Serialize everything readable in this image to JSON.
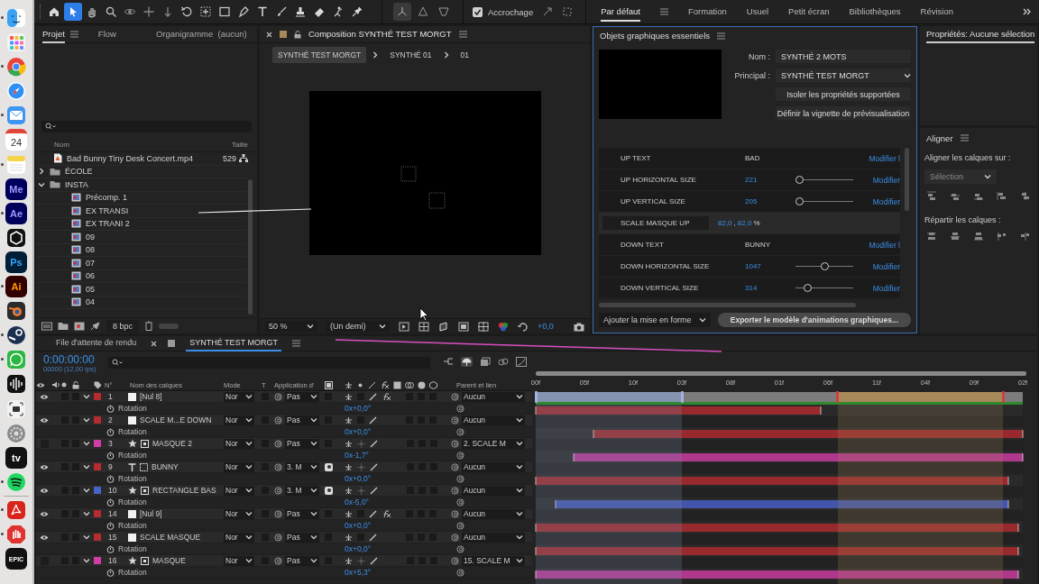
{
  "dock": [
    {
      "kind": "finder",
      "running": true
    },
    {
      "kind": "launchpad",
      "running": false
    },
    {
      "kind": "chrome",
      "running": true
    },
    {
      "kind": "safari",
      "running": false
    },
    {
      "kind": "mail",
      "running": true
    },
    {
      "kind": "calendar",
      "label": "24",
      "running": false
    },
    {
      "kind": "notes",
      "running": true
    },
    {
      "kind": "media",
      "label": "Me",
      "running": false
    },
    {
      "kind": "media",
      "label": "Ae",
      "running": true
    },
    {
      "kind": "capcut",
      "running": false
    },
    {
      "kind": "photo",
      "label": "Ps",
      "running": false
    },
    {
      "kind": "vector",
      "label": "Ai",
      "running": true
    },
    {
      "kind": "blender",
      "running": false
    },
    {
      "kind": "steam",
      "running": true
    },
    {
      "kind": "whatsapp",
      "running": true
    },
    {
      "kind": "voice",
      "running": false
    },
    {
      "kind": "screenshot",
      "running": false
    },
    {
      "kind": "settings",
      "running": false
    },
    {
      "kind": "dark",
      "label": "tv",
      "running": false
    },
    {
      "kind": "spotify",
      "running": true
    },
    {
      "kind": "acrobat",
      "running": true
    },
    {
      "kind": "adblock",
      "running": true
    },
    {
      "kind": "dark",
      "label": "EPIC",
      "running": false
    }
  ],
  "tools": [
    {
      "kind": "home",
      "selected": false
    },
    {
      "kind": "select",
      "selected": true
    },
    {
      "kind": "hand",
      "selected": false
    },
    {
      "kind": "zoom",
      "selected": false
    },
    {
      "kind": "orbit",
      "selected": false
    },
    {
      "kind": "pan",
      "selected": false
    },
    {
      "kind": "dolly",
      "selected": false
    },
    {
      "kind": "rotate",
      "selected": false
    },
    {
      "kind": "anchor",
      "selected": false
    },
    {
      "kind": "rect",
      "selected": false
    },
    {
      "kind": "pen",
      "selected": false
    },
    {
      "kind": "text",
      "selected": false
    },
    {
      "kind": "brush",
      "selected": false
    },
    {
      "kind": "stamp",
      "selected": false
    },
    {
      "kind": "eraser",
      "selected": false
    },
    {
      "kind": "roto",
      "selected": false
    },
    {
      "kind": "puppet",
      "selected": false
    }
  ],
  "axis_tools": [
    {
      "kind": "local",
      "selected": true
    },
    {
      "kind": "world",
      "selected": false
    },
    {
      "kind": "view",
      "selected": false
    }
  ],
  "snapping": {
    "label": "Accrochage",
    "checked": true
  },
  "workspaces": [
    {
      "label": "Par défaut",
      "selected": true
    },
    {
      "label": "Formation",
      "selected": false
    },
    {
      "label": "Usuel",
      "selected": false
    },
    {
      "label": "Petit écran",
      "selected": false
    },
    {
      "label": "Bibliothèques",
      "selected": false
    },
    {
      "label": "Révision",
      "selected": false
    }
  ],
  "project": {
    "tabs": [
      {
        "label": "Projet",
        "selected": true
      },
      {
        "label": "Flow",
        "selected": false
      },
      {
        "label": "Organigramme  (aucun)",
        "selected": false
      }
    ],
    "columns": [
      "Nom",
      "Taille"
    ],
    "items": [
      {
        "kind": "footage",
        "name": "Bad Bunny Tiny Desk Concert.mp4",
        "size": "529"
      },
      {
        "kind": "folder",
        "name": "ÉCOLE",
        "expanded": false
      },
      {
        "kind": "folder",
        "name": "INSTA",
        "expanded": true,
        "children": [
          {
            "kind": "comp",
            "name": "Précomp. 1"
          },
          {
            "kind": "comp",
            "name": "EX TRANSI"
          },
          {
            "kind": "comp",
            "name": "EX TRANI 2"
          },
          {
            "kind": "comp",
            "name": "09"
          },
          {
            "kind": "comp",
            "name": "08"
          },
          {
            "kind": "comp",
            "name": "07"
          },
          {
            "kind": "comp",
            "name": "06"
          },
          {
            "kind": "comp",
            "name": "05"
          },
          {
            "kind": "comp",
            "name": "04"
          }
        ]
      }
    ],
    "depth": "8 bpc"
  },
  "composition": {
    "title": "Composition SYNTHÉ TEST MORGT",
    "breadcrumbs": [
      {
        "label": "SYNTHÉ TEST MORGT",
        "selected": true
      },
      {
        "label": "SYNTHÉ 01",
        "selected": false
      },
      {
        "label": "01",
        "selected": false
      }
    ],
    "zoom": "50 %",
    "resolution": "(Un demi)",
    "exposure": "+0,0"
  },
  "essential_graphics": {
    "title": "Objets graphiques essentiels",
    "name_label": "Nom :",
    "name": "SYNTHÉ 2 MOTS",
    "primary_label": "Principal :",
    "primary": "SYNTHÉ TEST MORGT",
    "buttons": [
      "Isoler les propriétés supportées",
      "Définir la vignette de prévisualisation"
    ],
    "properties": [
      {
        "kind": "text",
        "label": "UP TEXT",
        "value": "BAD",
        "action": "Modifier l"
      },
      {
        "kind": "slider",
        "label": "UP HORIZONTAL SIZE",
        "value": "221",
        "level": 0,
        "action": "Modifier"
      },
      {
        "kind": "slider",
        "label": "UP VERTICAL SIZE",
        "value": "205",
        "level": 0,
        "action": "Modifier"
      },
      {
        "kind": "scale",
        "label": "SCALE MASQUE UP",
        "value": "82,0",
        "separator": ",",
        "value2": "82,0",
        "unit": "%"
      },
      {
        "kind": "text",
        "label": "DOWN TEXT",
        "value": "BUNNY",
        "action": "Modifier l"
      },
      {
        "kind": "slider",
        "label": "DOWN HORIZONTAL SIZE",
        "value": "1047",
        "level": 0.5,
        "action": "Modifier"
      },
      {
        "kind": "slider",
        "label": "DOWN VERTICAL SIZE",
        "value": "314",
        "level": 0.17,
        "action": "Modifier"
      }
    ],
    "format": "Ajouter la mise en forme",
    "export": "Exporter le modèle d'animations graphiques..."
  },
  "properties_panel": {
    "title": "Propriétés: Aucune sélection"
  },
  "align": {
    "title": "Aligner",
    "align_to_label": "Aligner les calques sur :",
    "align_to": "Sélection",
    "distribute_label": "Répartir les calques :"
  },
  "timeline": {
    "tabs": [
      {
        "label": "File d'attente de rendu",
        "selected": false
      },
      {
        "label": "SYNTHÉ TEST MORGT",
        "selected": true
      }
    ],
    "time": "0:00:00:00",
    "frame_info": "00000 (12,00 ips)",
    "columns": [
      "N°",
      "Nom des calques",
      "Mode",
      "T",
      "Application d'",
      "Parent et lien"
    ],
    "ruler": [
      "00f",
      "05f",
      "10f",
      "03f",
      "08f",
      "01f",
      "06f",
      "11f",
      "04f",
      "09f",
      "02f"
    ],
    "regions": [
      {
        "color": "#8593b0",
        "start": {
          "level": 0
        },
        "end": {
          "level": 0.3
        }
      },
      {
        "color": "#a8895a",
        "start": {
          "level": 0.62
        },
        "end": {
          "level": 0.96
        }
      }
    ],
    "layers": [
      {
        "visible": true,
        "expanded": true,
        "color": "#b52b2f",
        "number": "1",
        "kind": "null",
        "name": "[Nul 8]",
        "mode": "Nor",
        "track_matte": "Pas",
        "matte_icon": false,
        "fx": true,
        "parent": "Aucun",
        "property": "Rotation",
        "rotation": "0x+0,0°",
        "start": {
          "level": 0
        },
        "end": {
          "level": 0.585
        }
      },
      {
        "visible": true,
        "expanded": true,
        "color": "#b52b2f",
        "number": "2",
        "kind": "null",
        "name": "SCALE M...E DOWN",
        "mode": "Nor",
        "track_matte": "Pas",
        "matte_icon": false,
        "fx": false,
        "parent": "Aucun",
        "property": "Rotation",
        "rotation": "0x+0,0°",
        "start": {
          "level": 0.118
        },
        "end": {
          "level": 1
        }
      },
      {
        "visible": false,
        "expanded": true,
        "color": "#d23ca6",
        "number": "3",
        "kind": "shape",
        "name": "MASQUE 2",
        "mode": "Nor",
        "track_matte": "Pas",
        "matte_icon": false,
        "fx": false,
        "parent": "2. SCALE M",
        "property": "Rotation",
        "rotation": "0x-1,7°",
        "start": {
          "level": 0.078
        },
        "end": {
          "level": 1
        }
      },
      {
        "visible": true,
        "expanded": true,
        "color": "#b52b2f",
        "number": "9",
        "kind": "text",
        "name": "BUNNY",
        "mode": "Nor",
        "track_matte": "3. M",
        "matte_icon": true,
        "fx": false,
        "parent": "Aucun",
        "property": "Rotation",
        "rotation": "0x+0,0°",
        "start": {
          "level": 0
        },
        "end": {
          "level": 0.97
        }
      },
      {
        "visible": true,
        "expanded": true,
        "color": "#4a62cc",
        "number": "10",
        "kind": "shape",
        "name": "RECTANGLE BAS",
        "mode": "Nor",
        "track_matte": "3. M",
        "matte_icon": true,
        "fx": false,
        "parent": "Aucun",
        "property": "Rotation",
        "rotation": "0x-5,0°",
        "start": {
          "level": 0.04
        },
        "end": {
          "level": 0.97
        }
      },
      {
        "visible": true,
        "expanded": true,
        "color": "#b52b2f",
        "number": "14",
        "kind": "null",
        "name": "[Nul 9]",
        "mode": "Nor",
        "track_matte": "Pas",
        "matte_icon": false,
        "fx": true,
        "parent": "Aucun",
        "property": "Rotation",
        "rotation": "0x+0,0°",
        "start": {
          "level": 0
        },
        "end": {
          "level": 0.99
        }
      },
      {
        "visible": true,
        "expanded": true,
        "color": "#b52b2f",
        "number": "15",
        "kind": "null",
        "name": "SCALE MASQUE",
        "mode": "Nor",
        "track_matte": "Pas",
        "matte_icon": false,
        "fx": false,
        "parent": "Aucun",
        "property": "Rotation",
        "rotation": "0x+0,0°",
        "start": {
          "level": 0
        },
        "end": {
          "level": 0.99
        }
      },
      {
        "visible": false,
        "expanded": true,
        "color": "#d23ca6",
        "number": "16",
        "kind": "shape",
        "name": "MASQUE",
        "mode": "Nor",
        "track_matte": "Pas",
        "matte_icon": false,
        "fx": false,
        "parent": "15. SCALE M",
        "property": "Rotation",
        "rotation": "0x+5,3°",
        "start": {
          "level": 0
        },
        "end": {
          "level": 0.99
        }
      }
    ]
  }
}
